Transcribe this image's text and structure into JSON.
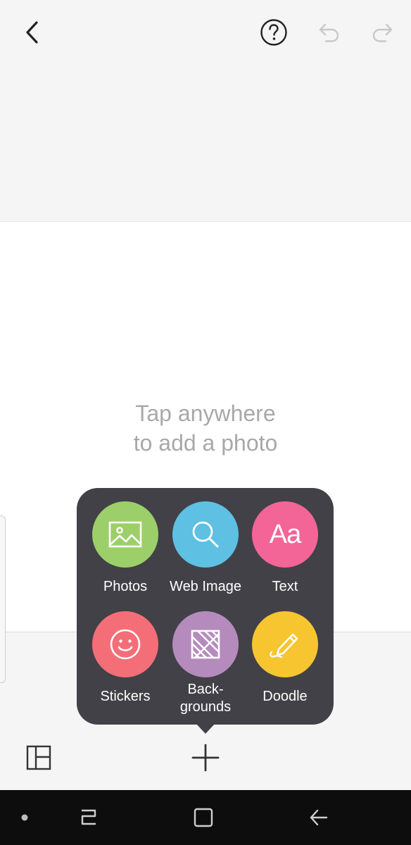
{
  "canvas": {
    "hint_line1": "Tap anywhere",
    "hint_line2": "to add a photo"
  },
  "add_menu": {
    "items": [
      {
        "label": "Photos",
        "icon": "image-icon",
        "color": "#9ccf6a"
      },
      {
        "label": "Web Image",
        "icon": "search-icon",
        "color": "#5ec0e3"
      },
      {
        "label": "Text",
        "icon": "text-aa-icon",
        "color": "#f36596",
        "glyph": "Aa"
      },
      {
        "label": "Stickers",
        "icon": "smiley-icon",
        "color": "#f46e78"
      },
      {
        "label_line1": "Back-",
        "label_line2": "grounds",
        "icon": "background-pattern-icon",
        "color": "#b58bbd"
      },
      {
        "label": "Doodle",
        "icon": "pencil-icon",
        "color": "#f6c530"
      }
    ]
  },
  "icons": {
    "top_bar": [
      "back-arrow-icon",
      "help-icon",
      "undo-icon",
      "redo-icon"
    ],
    "bottom_bar": [
      "layout-grid-icon",
      "add-icon"
    ],
    "system_nav": [
      "nav-dot-icon",
      "recent-apps-icon",
      "home-icon",
      "back-icon"
    ]
  }
}
